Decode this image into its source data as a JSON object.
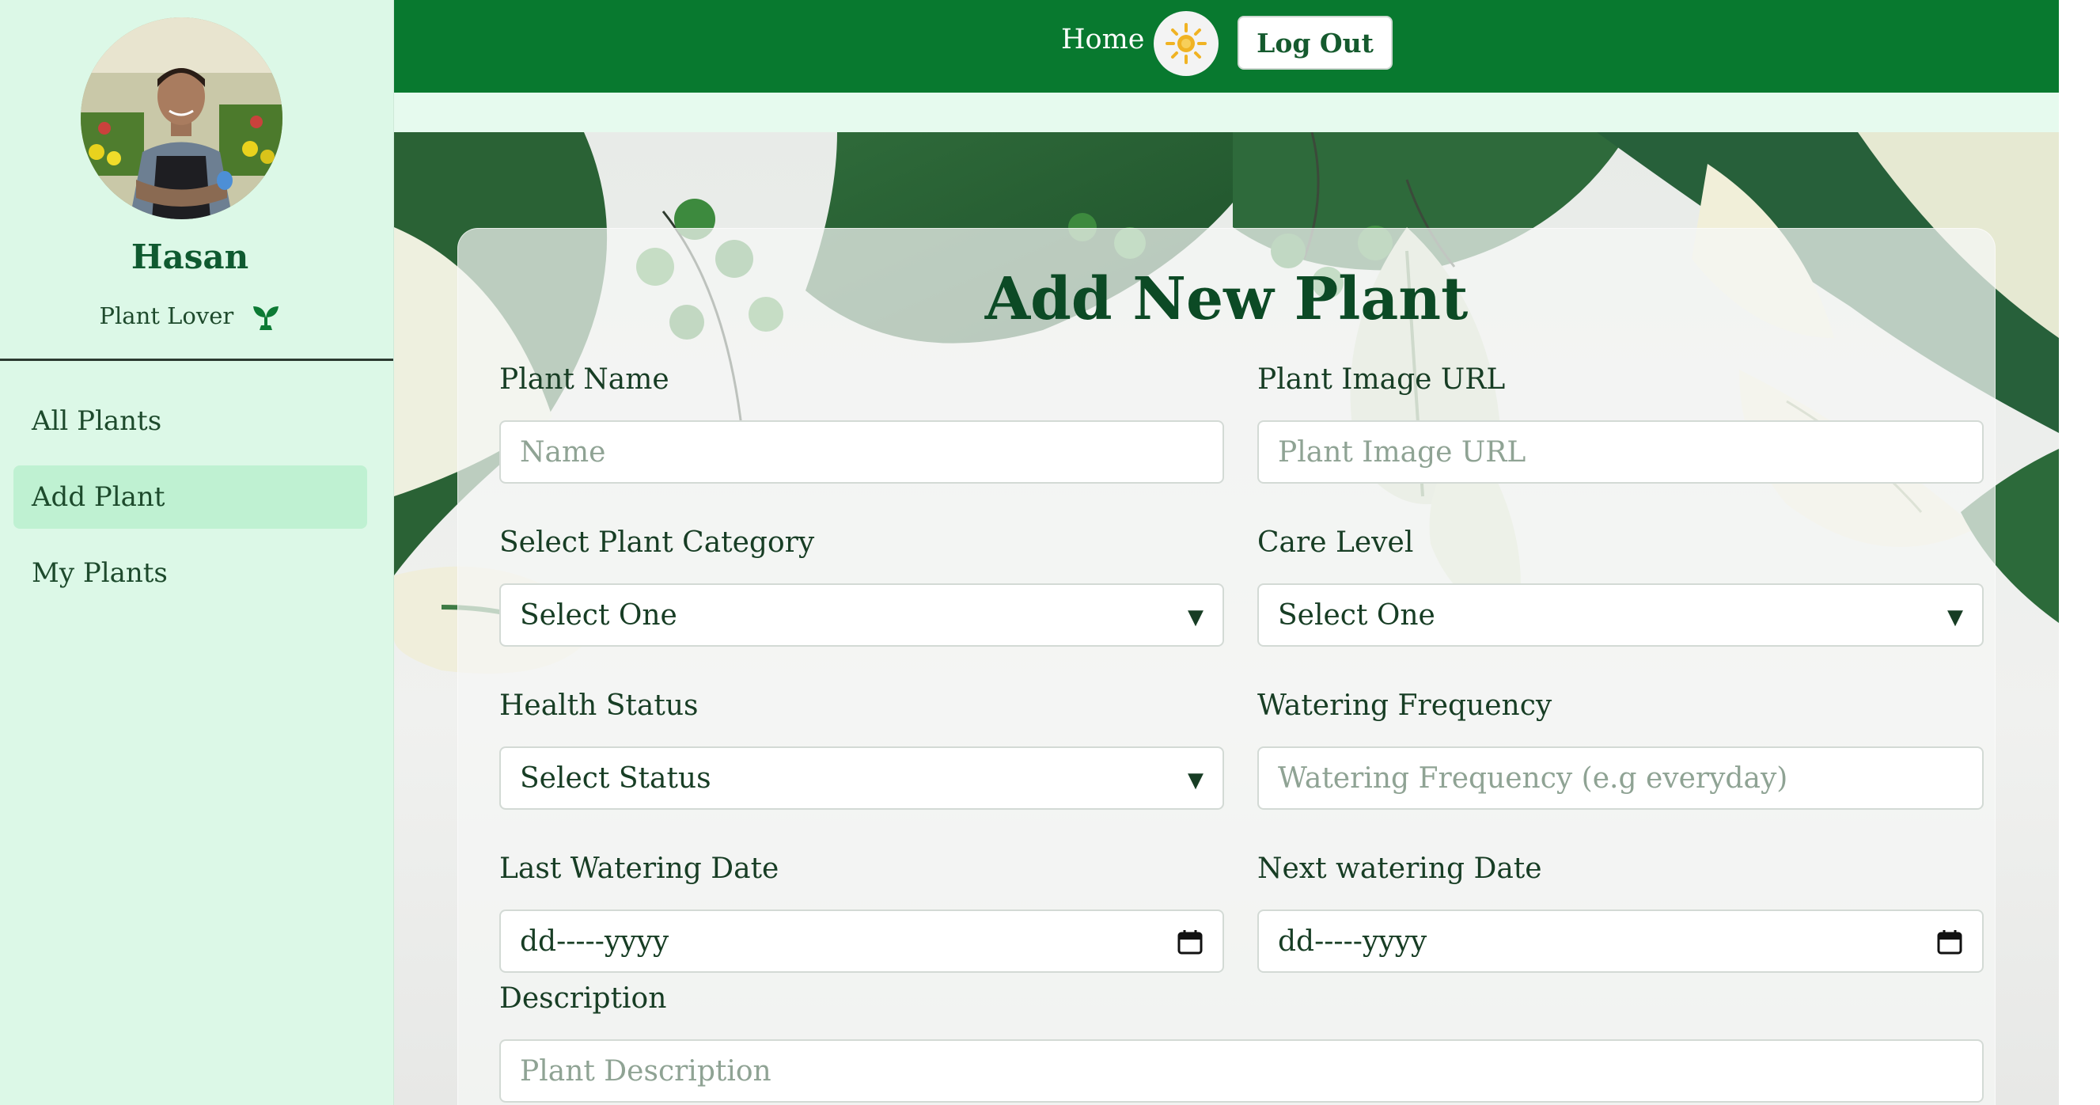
{
  "profile": {
    "name": "Hasan",
    "role": "Plant Lover"
  },
  "sidebar": {
    "items": [
      {
        "label": "All Plants",
        "active": false
      },
      {
        "label": "Add Plant",
        "active": true
      },
      {
        "label": "My Plants",
        "active": false
      }
    ]
  },
  "topbar": {
    "home_label": "Home",
    "theme_icon": "sun-icon",
    "logout_label": "Log Out"
  },
  "form": {
    "title": "Add New Plant",
    "plant_name": {
      "label": "Plant Name",
      "placeholder": "Name"
    },
    "plant_image_url": {
      "label": "Plant Image URL",
      "placeholder": "Plant Image URL"
    },
    "category": {
      "label": "Select Plant Category",
      "value": "Select One"
    },
    "care_level": {
      "label": "Care Level",
      "value": "Select One"
    },
    "health_status": {
      "label": "Health Status",
      "value": "Select Status"
    },
    "watering_frequency": {
      "label": "Watering Frequency",
      "placeholder": "Watering Frequency (e.g everyday)"
    },
    "last_watering_date": {
      "label": "Last Watering Date",
      "value": "dd-----yyyy"
    },
    "next_watering_date": {
      "label": "Next watering Date",
      "value": "dd-----yyyy"
    },
    "description": {
      "label": "Description",
      "placeholder": "Plant Description"
    }
  },
  "colors": {
    "brand_green": "#08792f",
    "sidebar_bg": "#dcf8e7",
    "active_item_bg": "#bff1d2",
    "title_green": "#0c4a25",
    "sun_yellow": "#f0b323"
  }
}
